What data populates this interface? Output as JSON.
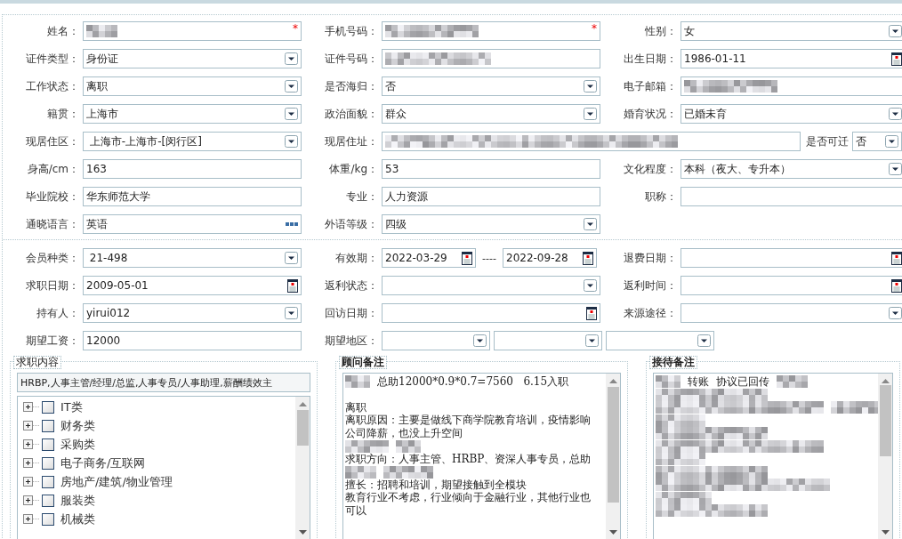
{
  "required_symbol": "*",
  "sections": [
    {
      "rows": [
        [
          {
            "label": "姓名：",
            "kind": "field",
            "required": true,
            "controls": [
              {
                "kind": "redacted"
              }
            ]
          },
          {
            "label": "手机号码：",
            "kind": "field",
            "required": true,
            "controls": [
              {
                "kind": "redacted"
              }
            ]
          },
          {
            "label": "性别：",
            "kind": "field",
            "required": false,
            "controls": [
              {
                "kind": "select",
                "value": "女"
              }
            ]
          }
        ],
        [
          {
            "label": "证件类型：",
            "kind": "field",
            "required": false,
            "controls": [
              {
                "kind": "select",
                "value": "身份证"
              }
            ]
          },
          {
            "label": "证件号码：",
            "kind": "field",
            "required": false,
            "controls": [
              {
                "kind": "redacted"
              }
            ]
          },
          {
            "label": "出生日期：",
            "kind": "field",
            "required": false,
            "controls": [
              {
                "kind": "date",
                "value": "1986-01-11"
              }
            ]
          }
        ],
        [
          {
            "label": "工作状态：",
            "kind": "field",
            "required": false,
            "controls": [
              {
                "kind": "select",
                "value": "离职"
              }
            ]
          },
          {
            "label": "是否海归：",
            "kind": "field",
            "required": false,
            "controls": [
              {
                "kind": "select",
                "value": "否"
              }
            ]
          },
          {
            "label": "电子邮箱：",
            "kind": "field",
            "required": false,
            "controls": [
              {
                "kind": "redacted"
              }
            ]
          }
        ],
        [
          {
            "label": "籍贯：",
            "kind": "field",
            "required": false,
            "controls": [
              {
                "kind": "select",
                "value": "上海市"
              }
            ]
          },
          {
            "label": "政治面貌：",
            "kind": "field",
            "required": false,
            "controls": [
              {
                "kind": "select",
                "value": "群众"
              }
            ]
          },
          {
            "label": "婚育状况：",
            "kind": "field",
            "required": false,
            "controls": [
              {
                "kind": "select",
                "value": "已婚未育"
              }
            ]
          }
        ],
        [
          {
            "label": "现居住区：",
            "kind": "field",
            "required": false,
            "controls": [
              {
                "kind": "select",
                "value": " 上海市-上海市-[闵行区]"
              }
            ]
          },
          {
            "label": "现居住址：",
            "kind": "wide",
            "required": false,
            "controls": [
              {
                "kind": "redacted"
              }
            ]
          },
          {
            "label": "是否可迁",
            "kind": "compact",
            "required": false,
            "controls": [
              {
                "kind": "select",
                "value": "否"
              }
            ]
          }
        ],
        [
          {
            "label": "身高/cm：",
            "kind": "field",
            "required": false,
            "controls": [
              {
                "kind": "text",
                "value": "163"
              }
            ]
          },
          {
            "label": "体重/kg：",
            "kind": "field",
            "required": false,
            "controls": [
              {
                "kind": "text",
                "value": "53"
              }
            ]
          },
          {
            "label": "文化程度：",
            "kind": "field",
            "required": false,
            "controls": [
              {
                "kind": "select",
                "value": "本科（夜大、专升本）"
              }
            ]
          }
        ],
        [
          {
            "label": "毕业院校：",
            "kind": "field",
            "required": false,
            "controls": [
              {
                "kind": "text",
                "value": "华东师范大学"
              }
            ]
          },
          {
            "label": "专业：",
            "kind": "field",
            "required": false,
            "controls": [
              {
                "kind": "text",
                "value": "人力资源"
              }
            ]
          },
          {
            "label": "职称：",
            "kind": "field",
            "required": false,
            "controls": [
              {
                "kind": "text"
              }
            ]
          }
        ],
        [
          {
            "label": "通晓语言：",
            "kind": "field",
            "required": false,
            "controls": [
              {
                "kind": "more",
                "value": "英语"
              }
            ]
          },
          {
            "label": "外语等级：",
            "kind": "field",
            "required": false,
            "controls": [
              {
                "kind": "select",
                "value": "四级"
              }
            ]
          }
        ]
      ]
    },
    {
      "rows": [
        [
          {
            "label": "会员种类：",
            "kind": "field",
            "required": false,
            "controls": [
              {
                "kind": "select",
                "value": " 21-498"
              }
            ]
          },
          {
            "label": "有效期：",
            "kind": "field",
            "required": false,
            "controls": [
              {
                "kind": "date",
                "value": "2022-03-29"
              },
              {
                "kind": "separator",
                "value": "----"
              },
              {
                "kind": "date",
                "value": "2022-09-28"
              }
            ]
          },
          {
            "label": "退费日期：",
            "kind": "field",
            "required": false,
            "controls": [
              {
                "kind": "date"
              }
            ]
          }
        ],
        [
          {
            "label": "求职日期：",
            "kind": "field",
            "required": false,
            "controls": [
              {
                "kind": "date",
                "value": "2009-05-01"
              }
            ]
          },
          {
            "label": "返利状态：",
            "kind": "field",
            "required": false,
            "controls": [
              {
                "kind": "select"
              }
            ]
          },
          {
            "label": "返利时间：",
            "kind": "field",
            "required": false,
            "controls": [
              {
                "kind": "date"
              }
            ]
          }
        ],
        [
          {
            "label": "持有人：",
            "kind": "field",
            "required": false,
            "controls": [
              {
                "kind": "select",
                "value": "yirui012"
              }
            ]
          },
          {
            "label": "回访日期：",
            "kind": "field",
            "required": false,
            "controls": [
              {
                "kind": "date"
              }
            ]
          },
          {
            "label": "来源途径：",
            "kind": "field",
            "required": false,
            "controls": [
              {
                "kind": "select"
              }
            ]
          }
        ],
        [
          {
            "label": "期望工资：",
            "kind": "field",
            "required": false,
            "controls": [
              {
                "kind": "text",
                "value": "12000"
              }
            ]
          },
          {
            "label": "期望地区：",
            "kind": "wide",
            "required": false,
            "controls": [
              {
                "kind": "select"
              },
              {
                "kind": "select"
              },
              {
                "kind": "select"
              }
            ]
          }
        ]
      ]
    }
  ],
  "panels": [
    {
      "kind": "tree",
      "legend": "求职内容",
      "bold": false,
      "summary": "HRBP,人事主管/经理/总监,人事专员/人事助理,薪酬绩效主",
      "items": [
        {
          "label": "IT类",
          "checked": false,
          "expanded": false
        },
        {
          "label": "财务类",
          "checked": false,
          "expanded": false
        },
        {
          "label": "采购类",
          "checked": false,
          "expanded": false
        },
        {
          "label": "电子商务/互联网",
          "checked": false,
          "expanded": false
        },
        {
          "label": "房地产/建筑/物业管理",
          "checked": false,
          "expanded": false
        },
        {
          "label": "服装类",
          "checked": false,
          "expanded": false
        },
        {
          "label": "机械类",
          "checked": false,
          "expanded": false
        }
      ]
    },
    {
      "kind": "notes",
      "legend": "顾问备注",
      "bold": true,
      "lines": [
        {
          "kind": "text",
          "parts": [
            {
              "kind": "redacted"
            },
            {
              "kind": "text",
              "text": "总助12000*0.9*0.7=7560   6.15入职"
            }
          ]
        },
        {
          "kind": "blank"
        },
        {
          "kind": "text",
          "parts": [
            {
              "kind": "text",
              "text": "离职"
            }
          ]
        },
        {
          "kind": "text",
          "parts": [
            {
              "kind": "text",
              "text": "离职原因：主要是做线下商学院教育培训，疫情影响"
            }
          ]
        },
        {
          "kind": "text",
          "parts": [
            {
              "kind": "text",
              "text": "公司降薪，也没上升空间"
            }
          ]
        },
        {
          "kind": "text",
          "parts": [
            {
              "kind": "redacted"
            },
            {
              "kind": "redacted"
            }
          ]
        },
        {
          "kind": "text",
          "parts": [
            {
              "kind": "text",
              "text": "求职方向：人事主管、HRBP、资深人事专员，总助"
            }
          ]
        },
        {
          "kind": "text",
          "parts": [
            {
              "kind": "redacted"
            },
            {
              "kind": "redacted"
            }
          ]
        },
        {
          "kind": "text",
          "parts": [
            {
              "kind": "text",
              "text": "擅长：招聘和培训，期望接触到全模块"
            }
          ]
        },
        {
          "kind": "text",
          "parts": [
            {
              "kind": "text",
              "text": "教育行业不考虑，行业倾向于金融行业，其他行业也"
            }
          ]
        },
        {
          "kind": "text",
          "parts": [
            {
              "kind": "text",
              "text": "可以"
            }
          ]
        }
      ]
    },
    {
      "kind": "notes",
      "legend": "接待备注",
      "bold": true,
      "lines": [
        {
          "kind": "text",
          "parts": [
            {
              "kind": "redacted"
            },
            {
              "kind": "text",
              "text": "转账"
            },
            {
              "kind": "text",
              "text": "协议已回传"
            },
            {
              "kind": "redacted"
            }
          ]
        },
        {
          "kind": "text",
          "parts": [
            {
              "kind": "redacted"
            }
          ]
        },
        {
          "kind": "text",
          "parts": [
            {
              "kind": "redacted"
            },
            {
              "kind": "redacted"
            }
          ]
        },
        {
          "kind": "text",
          "parts": [
            {
              "kind": "redacted"
            }
          ]
        },
        {
          "kind": "text",
          "parts": [
            {
              "kind": "redacted"
            }
          ]
        },
        {
          "kind": "text",
          "parts": [
            {
              "kind": "redacted"
            }
          ]
        },
        {
          "kind": "text",
          "parts": [
            {
              "kind": "redacted"
            }
          ]
        },
        {
          "kind": "text",
          "parts": [
            {
              "kind": "redacted"
            }
          ]
        },
        {
          "kind": "text",
          "parts": [
            {
              "kind": "redacted"
            }
          ]
        },
        {
          "kind": "text",
          "parts": [
            {
              "kind": "redacted"
            }
          ]
        },
        {
          "kind": "text",
          "parts": [
            {
              "kind": "redacted"
            }
          ]
        }
      ]
    }
  ]
}
